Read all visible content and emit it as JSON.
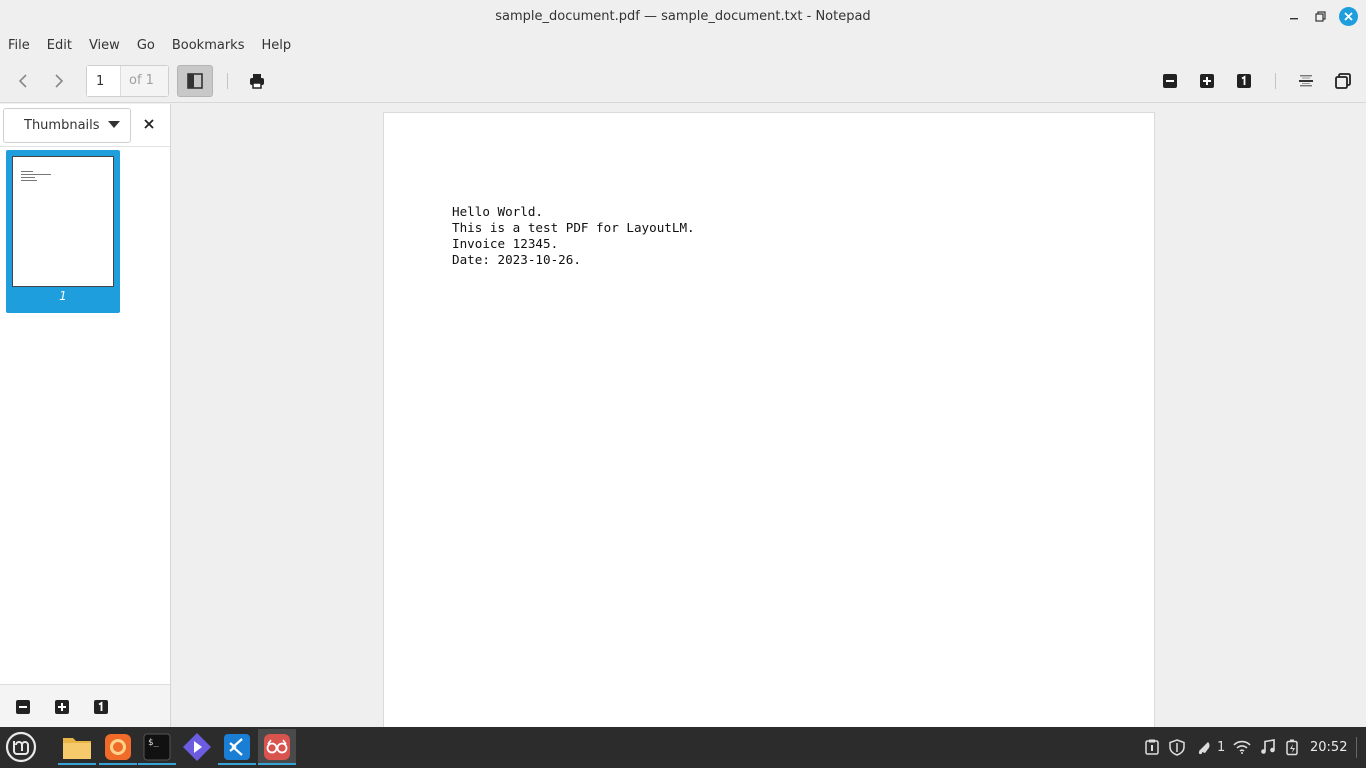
{
  "window": {
    "title": "sample_document.pdf — sample_document.txt - Notepad"
  },
  "menu": [
    "File",
    "Edit",
    "View",
    "Go",
    "Bookmarks",
    "Help"
  ],
  "toolbar": {
    "page_value": "1",
    "page_of": "of 1"
  },
  "sidebar": {
    "dropdown_label": "Thumbnails",
    "thumbnail_page_label": "1"
  },
  "document": {
    "lines": [
      "Hello World.",
      "This is a test PDF for LayoutLM.",
      "Invoice 12345.",
      "Date: 2023-10-26."
    ]
  },
  "taskbar": {
    "apps": [
      "menu",
      "files",
      "firefox",
      "terminal",
      "app-launcher",
      "vscode",
      "document-viewer"
    ],
    "notification_count": "1",
    "clock": "20:52"
  },
  "colors": {
    "accent": "#1f9ede",
    "taskbar": "#2c2c2c",
    "window_bg": "#efefef"
  },
  "icons": [
    "prev-icon",
    "next-icon",
    "sidebar-icon",
    "print-icon",
    "zoom-out-icon",
    "zoom-in-icon",
    "zoom-reset-icon",
    "continuous-icon",
    "dual-page-icon",
    "close-icon",
    "minimize-icon",
    "maximize-icon"
  ]
}
